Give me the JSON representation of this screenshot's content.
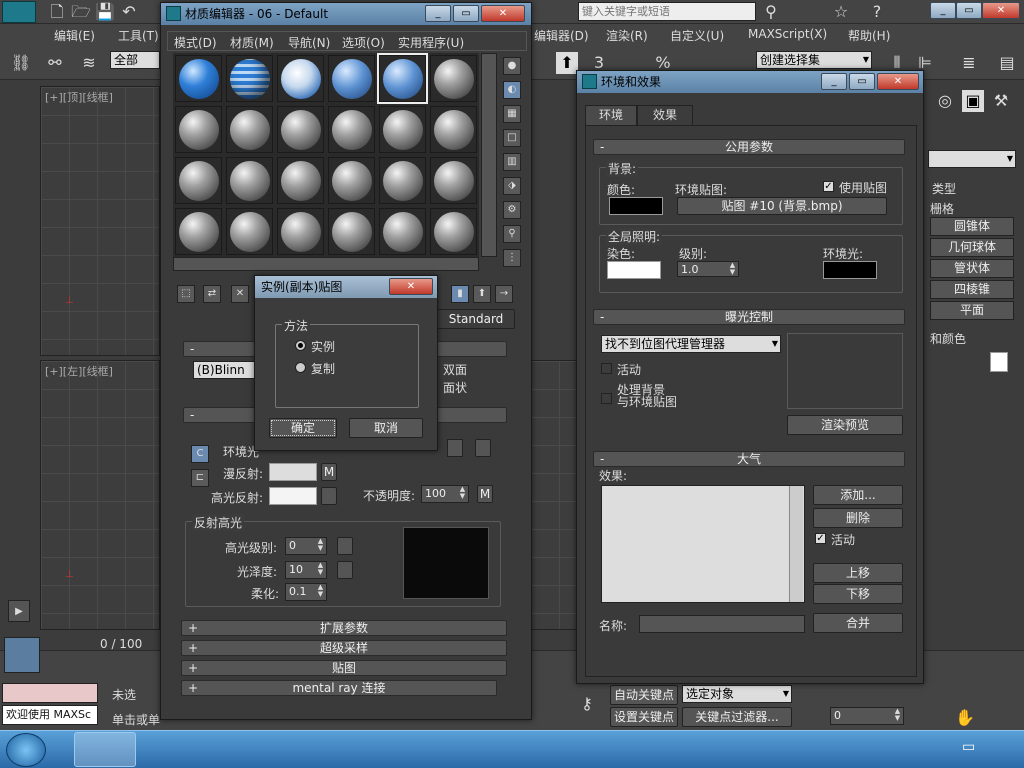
{
  "main": {
    "search_placeholder": "键入关键字或短语",
    "menu": [
      "编辑(E)",
      "工具(T)",
      "编辑器(D)",
      "渲染(R)",
      "自定义(U)",
      "MAXScript(X)",
      "帮助(H)"
    ],
    "selection_filter": "全部",
    "named_selection": "创建选择集",
    "viewport_top": "[+][顶][线框]",
    "viewport_left": "[+][左][线框]",
    "timeline": "0 / 100",
    "welcome": "欢迎使用 MAXSc",
    "status_left1": "未选",
    "status_left2": "单击或单",
    "auto_key": "自动关键点",
    "set_key": "设置关键点",
    "selected_object": "选定对象",
    "key_filter": "关键点过滤器...",
    "frame_value": "0",
    "command_panel": {
      "category_title": "类型",
      "grid_label": "栅格",
      "items": [
        "圆锥体",
        "几何球体",
        "管状体",
        "四棱锥",
        "平面"
      ],
      "name_color": "和颜色"
    }
  },
  "material_editor": {
    "title": "材质编辑器 - 06 - Default",
    "menu": [
      "模式(D)",
      "材质(M)",
      "导航(N)",
      "选项(O)",
      "实用程序(U)"
    ],
    "shader": "(B)Blinn",
    "two_sided": "双面",
    "faceted": "面状",
    "standard": "Standard",
    "ambient": "环境光",
    "diffuse": "漫反射:",
    "specular": "高光反射:",
    "opacity_label": "不透明度:",
    "opacity_value": "100",
    "spec_highlights": "反射高光",
    "spec_level_label": "高光级别:",
    "spec_level_value": "0",
    "gloss_label": "光泽度:",
    "gloss_value": "10",
    "soften_label": "柔化:",
    "soften_value": "0.1",
    "m_button": "M",
    "rollouts": [
      "扩展参数",
      "超级采样",
      "贴图",
      "mental ray 连接"
    ]
  },
  "instance_dialog": {
    "title": "实例(副本)贴图",
    "group_title": "方法",
    "option_instance": "实例",
    "option_copy": "复制",
    "ok": "确定",
    "cancel": "取消"
  },
  "environment": {
    "title": "环境和效果",
    "tab_env": "环境",
    "tab_effects": "效果",
    "common_params": "公用参数",
    "background": "背景:",
    "color": "颜色:",
    "env_map": "环境贴图:",
    "use_map": "使用贴图",
    "map_button": "贴图 #10 (背景.bmp)",
    "global_lighting": "全局照明:",
    "tint": "染色:",
    "level": "级别:",
    "level_value": "1.0",
    "ambient": "环境光:",
    "exposure_control": "曝光控制",
    "exposure_dropdown": "找不到位图代理管理器",
    "active": "活动",
    "process_bg": "处理背景",
    "env_map_2": "与环境贴图",
    "render_preview": "渲染预览",
    "atmosphere": "大气",
    "effects": "效果:",
    "add": "添加...",
    "delete": "删除",
    "active2": "活动",
    "move_up": "上移",
    "move_down": "下移",
    "name": "名称:",
    "merge": "合并"
  }
}
